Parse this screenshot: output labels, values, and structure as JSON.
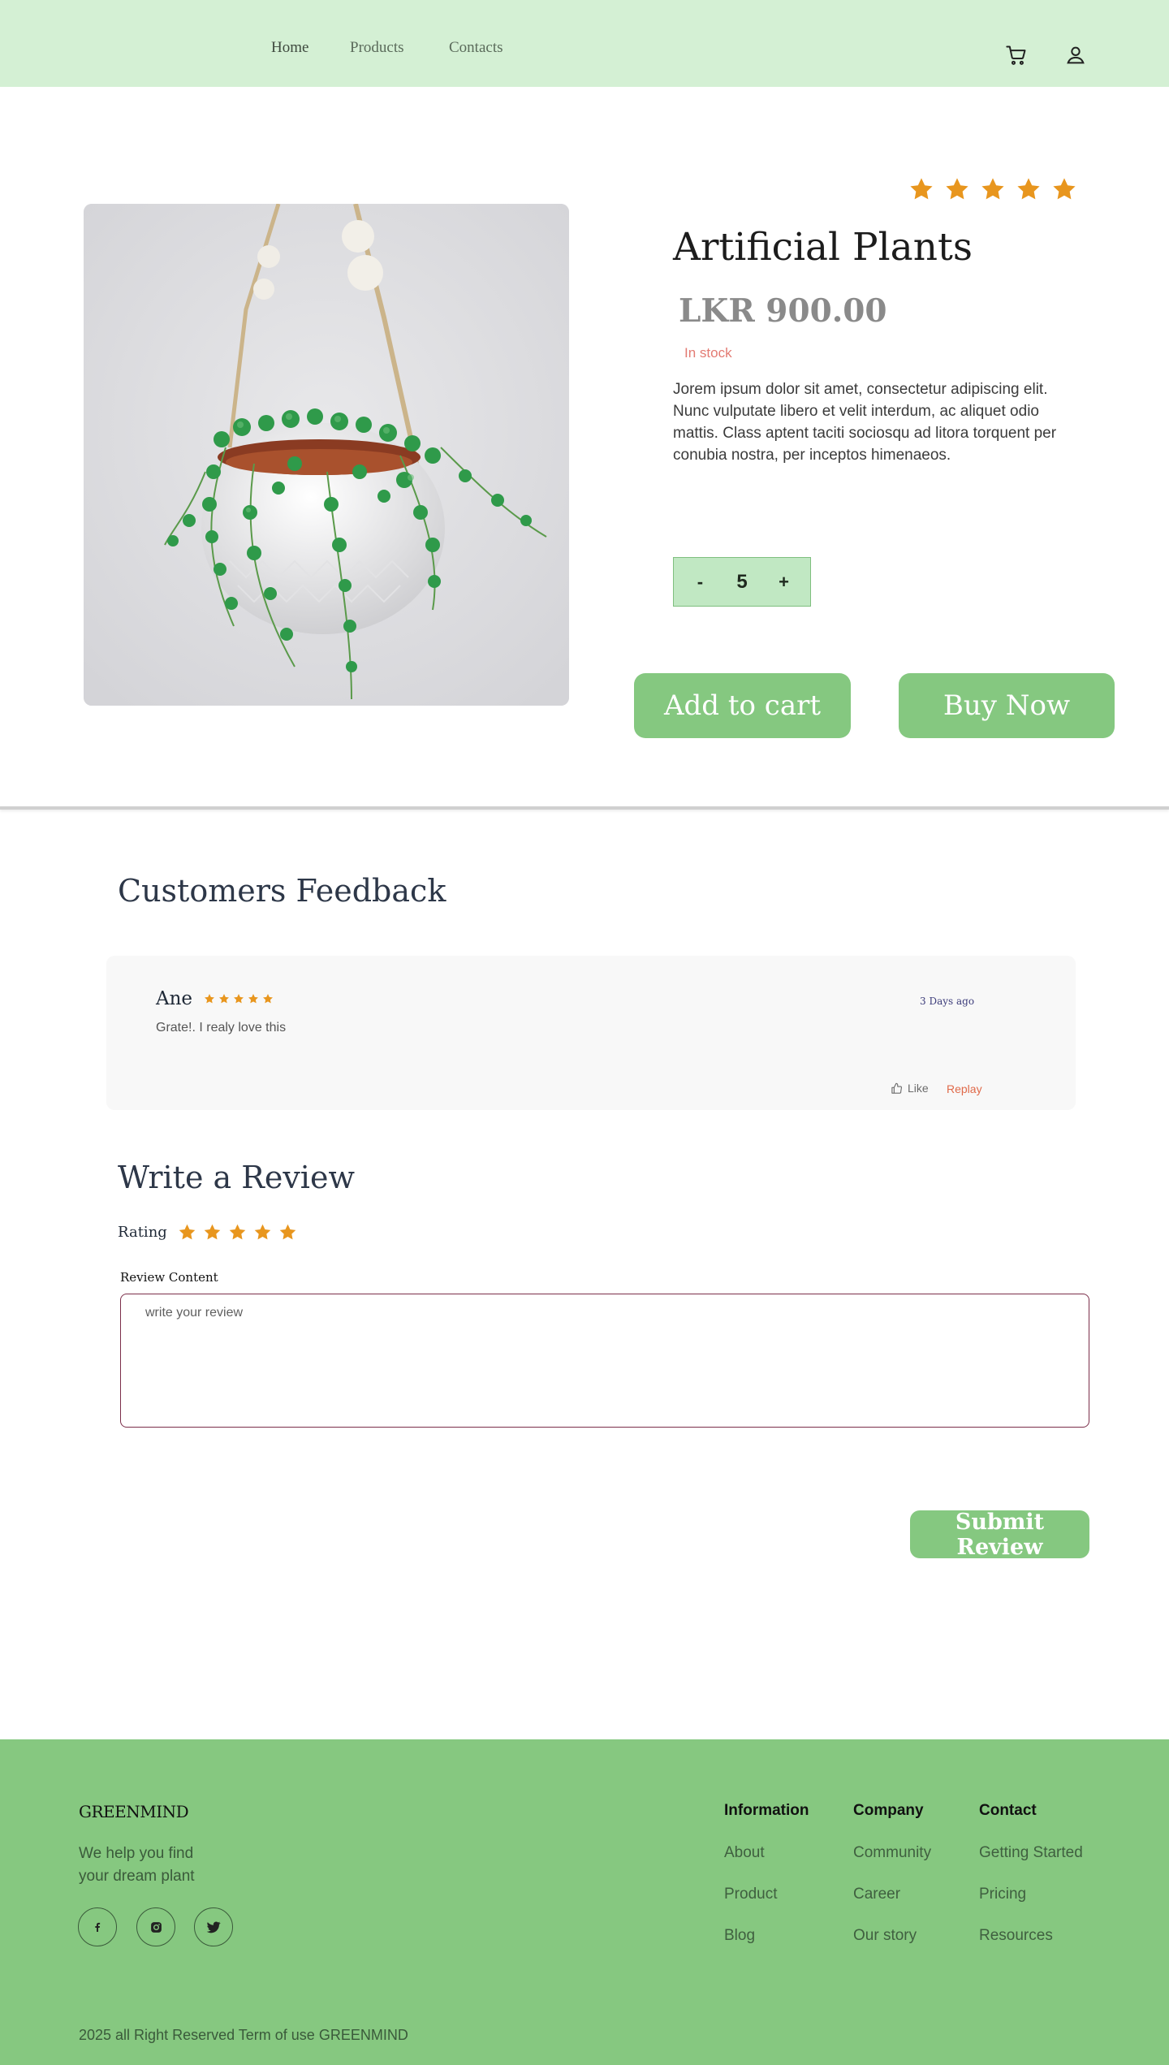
{
  "nav": {
    "home": "Home",
    "products": "Products",
    "contacts": "Contacts"
  },
  "header_icons": [
    "cart-icon",
    "user-icon"
  ],
  "product": {
    "title": "Artificial Plants",
    "price": "LKR 900.00",
    "stock": "In stock",
    "description": "Jorem ipsum dolor sit amet, consectetur adipiscing elit. Nunc vulputate libero et velit interdum, ac aliquet odio mattis. Class aptent taciti sociosqu ad litora torquent per conubia nostra, per inceptos himenaeos.",
    "rating": 5,
    "quantity": {
      "minus": "-",
      "value": "5",
      "plus": "+"
    },
    "add_to_cart": "Add to cart",
    "buy_now": "Buy Now"
  },
  "feedback": {
    "title": "Customers Feedback",
    "reviews": [
      {
        "name": "Ane",
        "rating": 5,
        "text": "Grate!. I realy love this",
        "date": "3 Days ago",
        "like": "Like",
        "reply": "Replay"
      }
    ]
  },
  "write_review": {
    "title": "Write a Review",
    "rating_label": "Rating",
    "rating": 5,
    "content_label": "Review Content",
    "placeholder": "write your review",
    "submit": "Submit Review"
  },
  "footer": {
    "brand": "GREENMIND",
    "tagline": "We help you find your dream plant",
    "social": [
      "facebook-icon",
      "instagram-icon",
      "twitter-icon"
    ],
    "columns": [
      {
        "heading": "Information",
        "links": [
          "About",
          "Product",
          "Blog"
        ]
      },
      {
        "heading": "Company",
        "links": [
          "Community",
          "Career",
          "Our story"
        ]
      },
      {
        "heading": "Contact",
        "links": [
          "Getting Started",
          "Pricing",
          "Resources"
        ]
      }
    ],
    "copyright": "2025 all Right Reserved Term of use GREENMIND"
  },
  "colors": {
    "header_bg": "#d4f0d4",
    "accent": "#85c880",
    "star": "#e8961e",
    "footer_bg": "#86c880"
  }
}
